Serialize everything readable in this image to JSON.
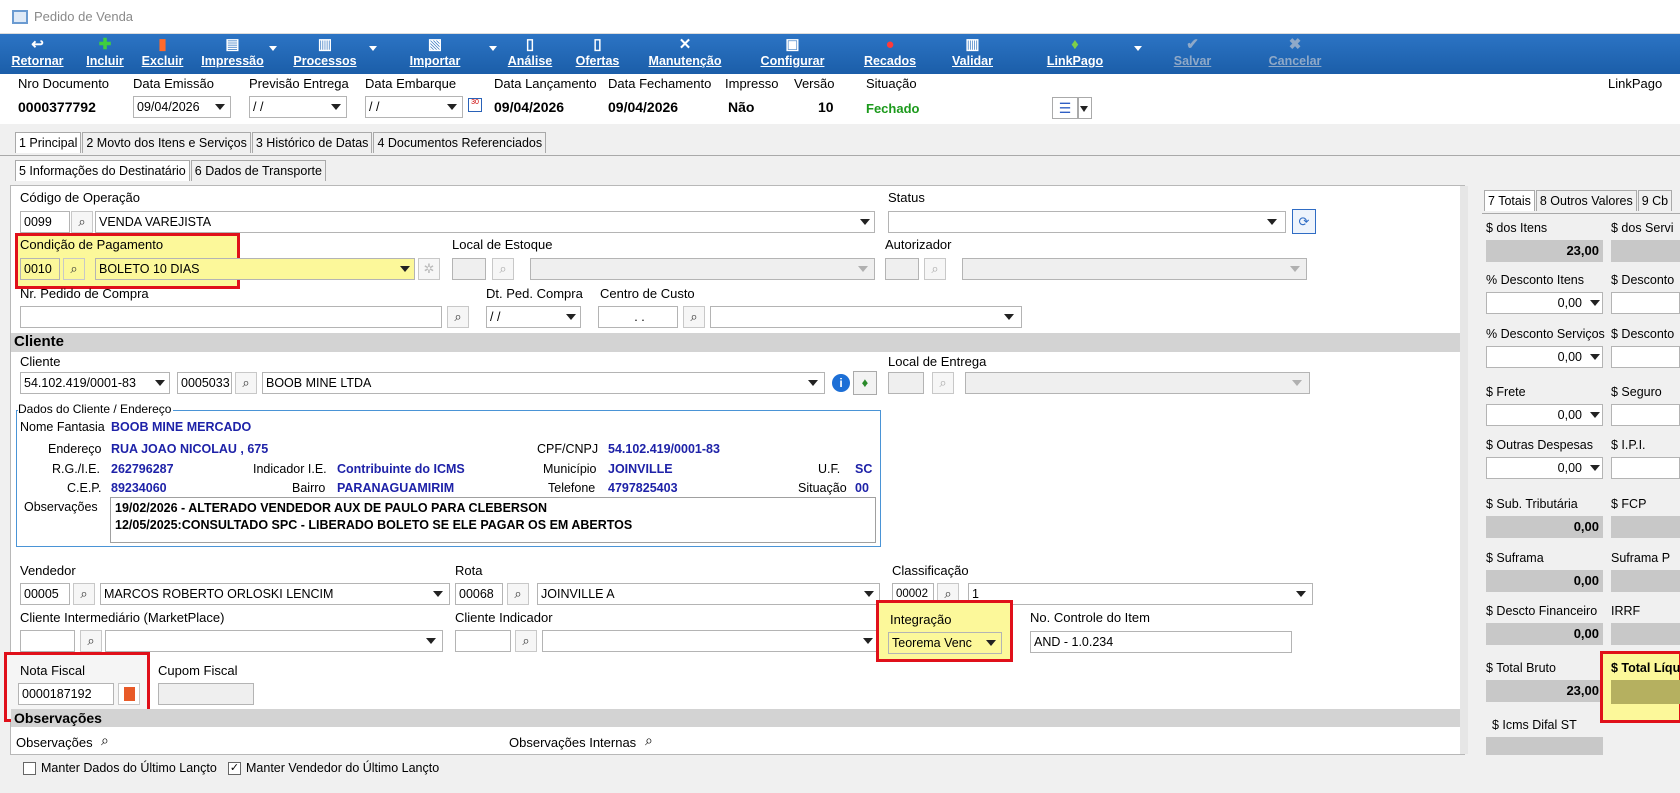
{
  "window": {
    "title": "Pedido de Venda"
  },
  "toolbar": [
    {
      "label": "Retornar",
      "icon": "return-icon",
      "glyph": "↩"
    },
    {
      "label": "Incluir",
      "icon": "plus-icon",
      "glyph": "✚"
    },
    {
      "label": "Excluir",
      "icon": "delete-icon",
      "glyph": "▮"
    },
    {
      "label": "Impressão",
      "icon": "printer-icon",
      "glyph": "▤"
    },
    {
      "label": "Processos",
      "icon": "process-icon",
      "glyph": "▥"
    },
    {
      "label": "Importar",
      "icon": "import-icon",
      "glyph": "▧"
    },
    {
      "label": "Análise",
      "icon": "analysis-icon",
      "glyph": "▯"
    },
    {
      "label": "Ofertas",
      "icon": "offers-icon",
      "glyph": "▯"
    },
    {
      "label": "Manutenção",
      "icon": "tools-icon",
      "glyph": "✕"
    },
    {
      "label": "Configurar",
      "icon": "configure-icon",
      "glyph": "▣"
    },
    {
      "label": "Recados",
      "icon": "message-icon",
      "glyph": "●"
    },
    {
      "label": "Validar",
      "icon": "validate-icon",
      "glyph": "▥"
    },
    {
      "label": "LinkPago",
      "icon": "money-bag-icon",
      "glyph": "♦"
    },
    {
      "label": "Salvar",
      "icon": "check-icon",
      "glyph": "✔"
    },
    {
      "label": "Cancelar",
      "icon": "cancel-icon",
      "glyph": "✖"
    }
  ],
  "header": {
    "nro_documento_label": "Nro Documento",
    "nro_documento": "0000377792",
    "data_emissao_label": "Data Emissão",
    "data_emissao": "09/04/2026",
    "previsao_entrega_label": "Previsão Entrega",
    "previsao_entrega": "/ /",
    "data_embarque_label": "Data Embarque",
    "data_embarque": "/ /",
    "data_lancamento_label": "Data Lançamento",
    "data_lancamento": "09/04/2026",
    "data_fechamento_label": "Data Fechamento",
    "data_fechamento": "09/04/2026",
    "impresso_label": "Impresso",
    "impresso": "Não",
    "versao_label": "Versão",
    "versao": "10",
    "situacao_label": "Situação",
    "situacao": "Fechado",
    "linkpago_label": "LinkPago"
  },
  "tabs": [
    "1 Principal",
    "2 Movto dos Itens e Serviços",
    "3 Histórico de Datas",
    "4 Documentos Referenciados"
  ],
  "subtabs": [
    "5 Informações do Destinatário",
    "6 Dados de Transporte"
  ],
  "form": {
    "codigo_operacao_label": "Código de Operação",
    "codigo_operacao": "0099",
    "codigo_operacao_desc": "VENDA VAREJISTA",
    "status_label": "Status",
    "condicao_label": "Condição de Pagamento",
    "condicao_code": "0010",
    "condicao_desc": "BOLETO 10 DIAS",
    "local_estoque_label": "Local de Estoque",
    "autorizador_label": "Autorizador",
    "pedido_compra_label": "Nr. Pedido de Compra",
    "dt_ped_label": "Dt. Ped. Compra",
    "dt_ped": "/ /",
    "centro_custo_label": "Centro de Custo",
    "centro_custo": ". .",
    "cliente_section": "Cliente",
    "cliente_label": "Cliente",
    "cliente_cnpj": "54.102.419/0001-83",
    "cliente_code": "0005033",
    "cliente_name": "BOOB MINE LTDA",
    "local_entrega_label": "Local de Entrega",
    "dados_label": "Dados do Cliente / Endereço",
    "nome_fantasia_label": "Nome Fantasia",
    "nome_fantasia": "BOOB MINE MERCADO",
    "endereco_label": "Endereço",
    "endereco": "RUA JOAO NICOLAU , 675",
    "cpf_label": "CPF/CNPJ",
    "cpf": "54.102.419/0001-83",
    "rg_label": "R.G./I.E.",
    "rg": "262796287",
    "indicador_label": "Indicador I.E.",
    "indicador": "Contribuinte do ICMS",
    "municipio_label": "Município",
    "municipio": "JOINVILLE",
    "uf_label": "U.F.",
    "uf": "SC",
    "cep_label": "C.E.P.",
    "cep": "89234060",
    "bairro_label": "Bairro",
    "bairro": "PARANAGUAMIRIM",
    "telefone_label": "Telefone",
    "telefone": "4797825403",
    "situacao_label": "Situação",
    "situacao": "00",
    "obs_label": "Observações",
    "obs1": "19/02/2026 - ALTERADO VENDEDOR AUX DE PAULO PARA CLEBERSON",
    "obs2": "12/05/2025:CONSULTADO SPC - LIBERADO BOLETO SE ELE PAGAR OS EM ABERTOS",
    "vendedor_label": "Vendedor",
    "vendedor_code": "00005",
    "vendedor_name": "MARCOS ROBERTO ORLOSKI LENCIM",
    "rota_label": "Rota",
    "rota_code": "00068",
    "rota_name": "JOINVILLE A",
    "classificacao_label": "Classificação",
    "classificacao_code": "00002",
    "classificacao_desc": "1",
    "intermediario_label": "Cliente Intermediário (MarketPlace)",
    "indicador_cli_label": "Cliente Indicador",
    "integracao_label": "Integração",
    "integracao": "Teorema Venc",
    "controle_label": "No. Controle do Item",
    "controle": "AND - 1.0.234",
    "nota_label": "Nota Fiscal",
    "nota": "0000187192",
    "cupom_label": "Cupom Fiscal",
    "obs_section": "Observações",
    "obs_field_label": "Observações",
    "obs_int_label": "Observações Internas",
    "chk1": "Manter Dados do Último Lançto",
    "chk2": "Manter Vendedor do Último Lançto"
  },
  "totals": {
    "tabs": [
      "7 Totais",
      "8 Outros Valores",
      "9 Cb"
    ],
    "itens_label": "$ dos Itens",
    "itens": "23,00",
    "servicos_label": "$ dos Servi",
    "desc_itens_label": "% Desconto Itens",
    "desc_itens": "0,00",
    "desconto2_label": "$ Desconto",
    "desc_serv_label": "% Desconto Serviços",
    "desc_serv": "0,00",
    "desconto3_label": "$ Desconto",
    "frete_label": "$ Frete",
    "frete": "0,00",
    "seguro_label": "$ Seguro",
    "outras_label": "$ Outras Despesas",
    "outras": "0,00",
    "ipi_label": "$ I.P.I.",
    "subtrib_label": "$ Sub. Tributária",
    "subtrib": "0,00",
    "fcp_label": "$ FCP",
    "suframa_label": "$ Suframa",
    "suframa": "0,00",
    "suframa_p_label": "Suframa P",
    "desc_fin_label": "$ Descto Financeiro",
    "desc_fin": "0,00",
    "irrf_label": "IRRF",
    "bruto_label": "$ Total Bruto",
    "bruto": "23,00",
    "liquido_label": "$ Total Líqu",
    "icms_label": "$ Icms Difal ST"
  }
}
